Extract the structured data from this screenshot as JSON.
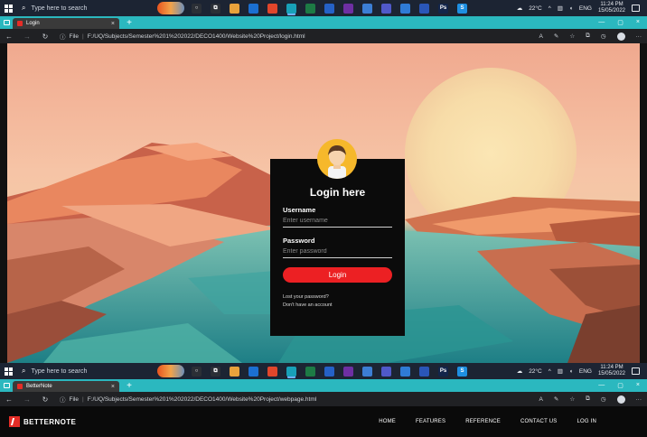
{
  "taskbar": {
    "search_placeholder": "Type here to search",
    "weather": "22°C",
    "language": "ENG",
    "time": "11:24 PM",
    "date": "15/05/2022",
    "apps": [
      {
        "name": "cortana",
        "color": "#2b2f36",
        "glyph": "○"
      },
      {
        "name": "task-view",
        "color": "#2b2f36",
        "glyph": "⧉"
      },
      {
        "name": "chrome",
        "color": "#e9a23b",
        "glyph": ""
      },
      {
        "name": "mail",
        "color": "#1b6fd1",
        "glyph": ""
      },
      {
        "name": "brave",
        "color": "#e1462b",
        "glyph": ""
      },
      {
        "name": "edge",
        "color": "#18a0b8",
        "glyph": ""
      },
      {
        "name": "excel",
        "color": "#1d7a45",
        "glyph": ""
      },
      {
        "name": "calendar",
        "color": "#2561c7",
        "glyph": ""
      },
      {
        "name": "onenote",
        "color": "#6e2fa3",
        "glyph": ""
      },
      {
        "name": "onedrive",
        "color": "#3c7ed4",
        "glyph": ""
      },
      {
        "name": "teams",
        "color": "#5059c9",
        "glyph": ""
      },
      {
        "name": "outlook",
        "color": "#2f7bd6",
        "glyph": ""
      },
      {
        "name": "word",
        "color": "#2a56b8",
        "glyph": ""
      },
      {
        "name": "photoshop",
        "color": "#13254a",
        "glyph": "Ps"
      },
      {
        "name": "skype",
        "color": "#1e8fe1",
        "glyph": "S"
      }
    ]
  },
  "browser_login": {
    "tab_title": "Login",
    "url_prefix": "File",
    "url": "F:/UQ/Subjects/Semester%201%202022/DECO1400/Website%20Project/login.html"
  },
  "login": {
    "title": "Login here",
    "username_label": "Username",
    "username_placeholder": "Enter username",
    "password_label": "Password",
    "password_placeholder": "Enter password",
    "submit_label": "Login",
    "lost_password": "Lost your password?",
    "no_account": "Don't have an account"
  },
  "browser_site": {
    "tab_title": "BetterNote",
    "url_prefix": "File",
    "url": "F:/UQ/Subjects/Semester%201%202022/DECO1400/Website%20Project/webpage.html"
  },
  "site": {
    "brand": "BETTERNOTE",
    "nav": [
      "HOME",
      "FEATURES",
      "REFERENCE",
      "CONTACT US",
      "LOG IN"
    ]
  },
  "colors": {
    "accent_red": "#ec2023",
    "browser_teal": "#2bb8bf",
    "avatar_yellow": "#f6b82b"
  }
}
